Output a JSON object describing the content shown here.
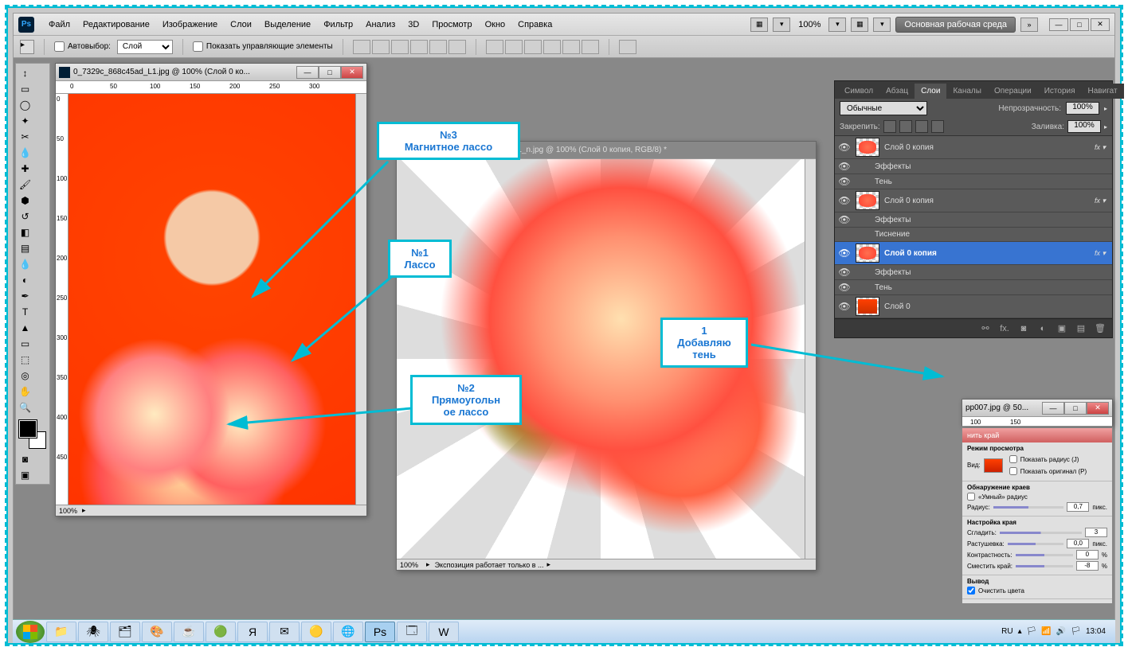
{
  "menubar": {
    "items": [
      "Файл",
      "Редактирование",
      "Изображение",
      "Слои",
      "Выделение",
      "Фильтр",
      "Анализ",
      "3D",
      "Просмотр",
      "Окно",
      "Справка"
    ],
    "zoom": "100%",
    "workspace_btn": "Основная рабочая среда"
  },
  "options": {
    "autoselect_label": "Автовыбор:",
    "autoselect_value": "Слой",
    "show_controls": "Показать управляющие элементы"
  },
  "doc1": {
    "title": "0_7329c_868c45ad_L1.jpg @ 100% (Слой 0 ко...",
    "ruler_h": [
      "0",
      "50",
      "100",
      "150",
      "200",
      "250",
      "300"
    ],
    "ruler_v": [
      "0",
      "50",
      "100",
      "150",
      "200",
      "250",
      "300",
      "350",
      "400",
      "450"
    ],
    "status_zoom": "100%"
  },
  "doc2": {
    "title": "9530651_308810479005228082 1_n.jpg @ 100% (Слой 0 копия, RGB/8) *",
    "status_zoom": "100%",
    "status_text": "Экспозиция работает только в ..."
  },
  "doc3": {
    "title": "pp007.jpg @ 50...",
    "ruler_h": [
      "100",
      "150"
    ]
  },
  "callouts": {
    "c1_line1": "№3",
    "c1_line2": "Магнитное лассо",
    "c2_line1": "№1",
    "c2_line2": "Лассо",
    "c3_line1": "№2",
    "c3_line2": "Прямоугольн",
    "c3_line3": "ое лассо",
    "c4_line1": "1",
    "c4_line2": "Добавляю",
    "c4_line3": "тень"
  },
  "layers_panel": {
    "tabs": [
      "Символ",
      "Абзац",
      "Слои",
      "Каналы",
      "Операции",
      "История",
      "Навигат"
    ],
    "active_tab": 2,
    "blend_mode": "Обычные",
    "opacity_label": "Непрозрачность:",
    "opacity_value": "100%",
    "lock_label": "Закрепить:",
    "fill_label": "Заливка:",
    "fill_value": "100%",
    "layers": [
      {
        "name": "Слой 0 копия",
        "fx": true,
        "effects": [
          "Эффекты",
          "Тень"
        ],
        "selected": false,
        "thumb": "rose"
      },
      {
        "name": "Слой 0 копия",
        "fx": true,
        "effects": [
          "Эффекты",
          "Тиснение"
        ],
        "selected": false,
        "thumb": "rose"
      },
      {
        "name": "Слой 0 копия",
        "fx": true,
        "effects": [
          "Эффекты",
          "Тень"
        ],
        "selected": true,
        "thumb": "rose"
      },
      {
        "name": "Слой 0",
        "fx": false,
        "effects": [],
        "selected": false,
        "thumb": "woman"
      }
    ]
  },
  "refine": {
    "title": "нить край",
    "view_mode": "Режим просмотра",
    "view_label": "Вид:",
    "show_radius": "Показать радиус (J)",
    "show_original": "Показать оригинал (P)",
    "edge_detect": "Обнаружение краев",
    "smart_radius": "«Умный» радиус",
    "radius_label": "Радиус:",
    "radius_val": "0,7",
    "radius_unit": "пикс.",
    "adjust_edge": "Настройка края",
    "smooth_label": "Сгладить:",
    "smooth_val": "3",
    "feather_label": "Растушевка:",
    "feather_val": "0,0",
    "feather_unit": "пикс.",
    "contrast_label": "Контрастность:",
    "contrast_val": "0",
    "contrast_unit": "%",
    "shift_label": "Сместить край:",
    "shift_val": "-8",
    "shift_unit": "%",
    "output": "Вывод",
    "decontaminate": "Очистить цвета"
  },
  "taskbar": {
    "lang": "RU",
    "time": "13:04"
  }
}
